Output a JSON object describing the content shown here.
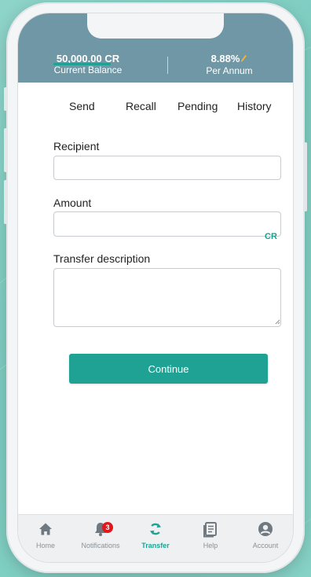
{
  "header": {
    "balance_value": "50,000.00 CR",
    "balance_label": "Current Balance",
    "rate_value": "8.88%",
    "rate_label": "Per Annum",
    "rate_icon": "pencil-icon"
  },
  "tabs": [
    {
      "label": "Send",
      "active": true
    },
    {
      "label": "Recall",
      "active": false
    },
    {
      "label": "Pending",
      "active": false
    },
    {
      "label": "History",
      "active": false
    }
  ],
  "form": {
    "recipient_label": "Recipient",
    "recipient_value": "",
    "amount_label": "Amount",
    "amount_value": "",
    "amount_unit": "CR",
    "description_label": "Transfer description",
    "description_value": "",
    "continue_label": "Continue"
  },
  "nav": [
    {
      "label": "Home",
      "icon": "home-icon",
      "active": false
    },
    {
      "label": "Notifications",
      "icon": "bell-icon",
      "active": false,
      "badge": "3"
    },
    {
      "label": "Transfer",
      "icon": "transfer-icon",
      "active": true
    },
    {
      "label": "Help",
      "icon": "help-book-icon",
      "active": false
    },
    {
      "label": "Account",
      "icon": "account-icon",
      "active": false
    }
  ],
  "colors": {
    "accent": "#1fa293",
    "header": "#6f97a6",
    "badge": "#e0171b",
    "pencil": "#f2b233",
    "background": "#86d2c6"
  }
}
